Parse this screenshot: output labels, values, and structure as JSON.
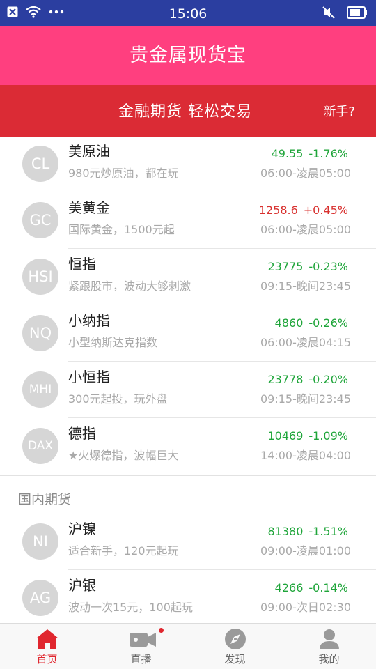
{
  "status_bar": {
    "time": "15:06"
  },
  "header": {
    "title": "贵金属现货宝"
  },
  "banner": {
    "slogan": "金融期货 轻松交易",
    "newbie": "新手?"
  },
  "products": [
    {
      "code": "CL",
      "name": "美原油",
      "desc": "980元炒原油，都在玩",
      "price": "49.55",
      "change": "-1.76%",
      "direction": "down",
      "hours": "06:00-凌晨05:00"
    },
    {
      "code": "GC",
      "name": "美黄金",
      "desc": "国际黄金，1500元起",
      "price": "1258.6",
      "change": "+0.45%",
      "direction": "up",
      "hours": "06:00-凌晨05:00"
    },
    {
      "code": "HSI",
      "name": "恒指",
      "desc": "紧跟股市，波动大够刺激",
      "price": "23775",
      "change": "-0.23%",
      "direction": "down",
      "hours": "09:15-晚间23:45"
    },
    {
      "code": "NQ",
      "name": "小纳指",
      "desc": "小型纳斯达克指数",
      "price": "4860",
      "change": "-0.26%",
      "direction": "down",
      "hours": "06:00-凌晨04:15"
    },
    {
      "code": "MHI",
      "name": "小恒指",
      "desc": "300元起投，玩外盘",
      "price": "23778",
      "change": "-0.20%",
      "direction": "down",
      "hours": "09:15-晚间23:45"
    },
    {
      "code": "DAX",
      "name": "德指",
      "desc": "★火爆德指，波幅巨大",
      "price": "10469",
      "change": "-1.09%",
      "direction": "down",
      "hours": "14:00-凌晨04:00"
    }
  ],
  "domestic_section": {
    "title": "国内期货",
    "items": [
      {
        "code": "NI",
        "name": "沪镍",
        "desc": "适合新手，120元起玩",
        "price": "81380",
        "change": "-1.51%",
        "direction": "down",
        "hours": "09:00-凌晨01:00"
      },
      {
        "code": "AG",
        "name": "沪银",
        "desc": "波动一次15元，100起玩",
        "price": "4266",
        "change": "-0.14%",
        "direction": "down",
        "hours": "09:00-次日02:30"
      }
    ]
  },
  "tabs": [
    {
      "label": "首页",
      "icon": "home-icon",
      "active": true
    },
    {
      "label": "直播",
      "icon": "video-camera-icon",
      "active": false,
      "badge_dot": true
    },
    {
      "label": "发现",
      "icon": "compass-icon",
      "active": false
    },
    {
      "label": "我的",
      "icon": "person-icon",
      "active": false
    }
  ],
  "colors": {
    "header": "#ff3f7f",
    "banner": "#db2b35",
    "status_bar": "#2b3ea0",
    "up": "#d8302e",
    "down": "#1fa53a",
    "tab_active": "#e0262e"
  }
}
